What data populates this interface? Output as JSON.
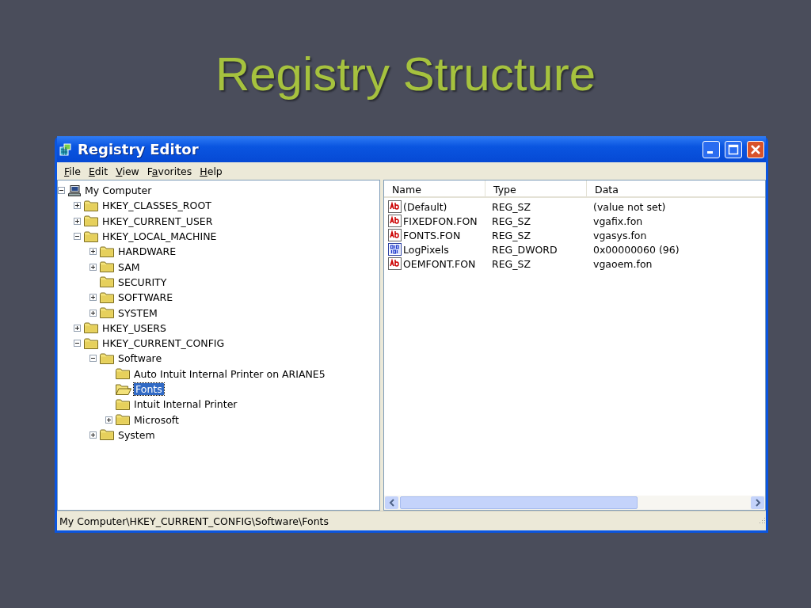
{
  "slide": {
    "title": "Registry Structure"
  },
  "window": {
    "title": "Registry Editor"
  },
  "menu": [
    {
      "access_key": "F",
      "after": "ile"
    },
    {
      "access_key": "E",
      "after": "dit"
    },
    {
      "access_key": "V",
      "after": "iew"
    },
    {
      "before": "F",
      "access_key": "a",
      "after": "vorites"
    },
    {
      "access_key": "H",
      "after": "elp"
    }
  ],
  "tree": [
    {
      "label": "My Computer",
      "kind": "computer",
      "expanded": true,
      "selected": false,
      "children": [
        {
          "label": "HKEY_CLASSES_ROOT",
          "kind": "folder",
          "expanded": false,
          "selected": false
        },
        {
          "label": "HKEY_CURRENT_USER",
          "kind": "folder",
          "expanded": false,
          "selected": false
        },
        {
          "label": "HKEY_LOCAL_MACHINE",
          "kind": "folder",
          "expanded": true,
          "selected": false,
          "children": [
            {
              "label": "HARDWARE",
              "kind": "folder",
              "expanded": false,
              "selected": false
            },
            {
              "label": "SAM",
              "kind": "folder",
              "expanded": false,
              "selected": false
            },
            {
              "label": "SECURITY",
              "kind": "folder",
              "selected": false
            },
            {
              "label": "SOFTWARE",
              "kind": "folder",
              "expanded": false,
              "selected": false
            },
            {
              "label": "SYSTEM",
              "kind": "folder",
              "expanded": false,
              "selected": false
            }
          ]
        },
        {
          "label": "HKEY_USERS",
          "kind": "folder",
          "expanded": false,
          "selected": false
        },
        {
          "label": "HKEY_CURRENT_CONFIG",
          "kind": "folder",
          "expanded": true,
          "selected": false,
          "children": [
            {
              "label": "Software",
              "kind": "folder",
              "expanded": true,
              "selected": false,
              "children": [
                {
                  "label": "Auto Intuit Internal Printer on ARIANE5",
                  "kind": "folder",
                  "selected": false
                },
                {
                  "label": "Fonts",
                  "kind": "folder",
                  "selected": true
                },
                {
                  "label": "Intuit Internal Printer",
                  "kind": "folder",
                  "selected": false
                },
                {
                  "label": "Microsoft",
                  "kind": "folder",
                  "expanded": false,
                  "selected": false
                }
              ]
            },
            {
              "label": "System",
              "kind": "folder",
              "expanded": false,
              "selected": false
            }
          ]
        }
      ]
    }
  ],
  "values": {
    "columns": [
      "Name",
      "Type",
      "Data"
    ],
    "rows": [
      {
        "kind": "string",
        "name": "(Default)",
        "type": "REG_SZ",
        "data": "(value not set)"
      },
      {
        "kind": "string",
        "name": "FIXEDFON.FON",
        "type": "REG_SZ",
        "data": "vgafix.fon"
      },
      {
        "kind": "string",
        "name": "FONTS.FON",
        "type": "REG_SZ",
        "data": "vgasys.fon"
      },
      {
        "kind": "dword",
        "name": "LogPixels",
        "type": "REG_DWORD",
        "data": "0x00000060 (96)"
      },
      {
        "kind": "string",
        "name": "OEMFONT.FON",
        "type": "REG_SZ",
        "data": "vgaoem.fon"
      }
    ]
  },
  "status_bar": "My Computer\\HKEY_CURRENT_CONFIG\\Software\\Fonts"
}
